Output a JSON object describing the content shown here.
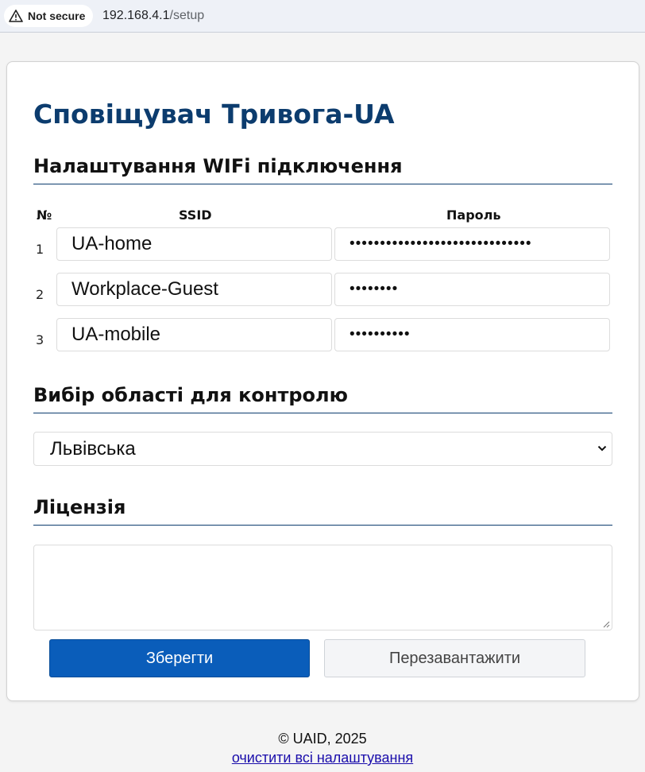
{
  "browser": {
    "security_label": "Not secure",
    "url_host": "192.168.4.1",
    "url_path": "/setup"
  },
  "page": {
    "title": "Сповіщувач Тривога-UA"
  },
  "wifi": {
    "section_title": "Налаштування WIFi підключення",
    "col_num": "№",
    "col_ssid": "SSID",
    "col_password": "Пароль",
    "rows": [
      {
        "num": "1",
        "ssid": "UA-home",
        "password": "••••••••••••••••••••••••••••••"
      },
      {
        "num": "2",
        "ssid": "Workplace-Guest",
        "password": "••••••••"
      },
      {
        "num": "3",
        "ssid": "UA-mobile",
        "password": "••••••••••"
      }
    ]
  },
  "region": {
    "section_title": "Вибір області для контролю",
    "selected": "Львівська"
  },
  "license": {
    "section_title": "Ліцензія",
    "value": ""
  },
  "actions": {
    "save_label": "Зберегти",
    "reboot_label": "Перезавантажити"
  },
  "footer": {
    "copyright": "© UAID, 2025",
    "reset_link": "очистити всі налаштування"
  }
}
